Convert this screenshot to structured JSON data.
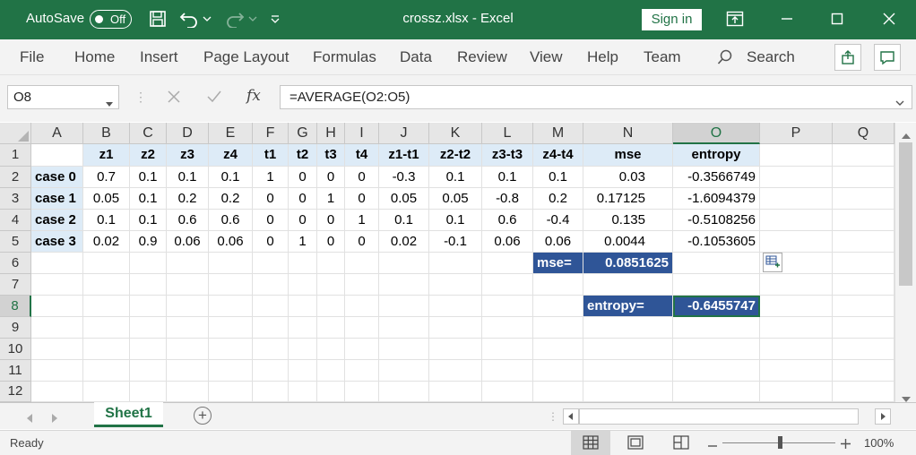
{
  "titlebar": {
    "autosave_label": "AutoSave",
    "autosave_state": "Off",
    "title": "crossz.xlsx  -  Excel",
    "sign_in": "Sign in",
    "icons": [
      "save-icon",
      "undo-icon",
      "redo-icon",
      "customize-qat-icon",
      "ribbon-display-icon",
      "minimize-icon",
      "maximize-icon",
      "close-icon"
    ]
  },
  "menu": {
    "items": [
      "File",
      "Home",
      "Insert",
      "Page Layout",
      "Formulas",
      "Data",
      "Review",
      "View",
      "Help",
      "Team"
    ],
    "search": "Search"
  },
  "formula_bar": {
    "name_box": "O8",
    "formula": "=AVERAGE(O2:O5)",
    "fx": "fx"
  },
  "sheet": {
    "columns": [
      "A",
      "B",
      "C",
      "D",
      "E",
      "F",
      "G",
      "H",
      "I",
      "J",
      "K",
      "L",
      "M",
      "N",
      "O",
      "P",
      "Q"
    ],
    "rows": [
      "1",
      "2",
      "3",
      "4",
      "5",
      "6",
      "7",
      "8",
      "9",
      "10",
      "11",
      "12"
    ],
    "header_row": [
      "",
      "z1",
      "z2",
      "z3",
      "z4",
      "t1",
      "t2",
      "t3",
      "t4",
      "z1-t1",
      "z2-t2",
      "z3-t3",
      "z4-t4",
      "mse",
      "entropy"
    ],
    "data_rows": [
      [
        "case 0",
        "0.7",
        "0.1",
        "0.1",
        "0.1",
        "1",
        "0",
        "0",
        "0",
        "-0.3",
        "0.1",
        "0.1",
        "0.1",
        "0.03",
        "-0.3566749"
      ],
      [
        "case 1",
        "0.05",
        "0.1",
        "0.2",
        "0.2",
        "0",
        "0",
        "1",
        "0",
        "0.05",
        "0.05",
        "-0.8",
        "0.2",
        "0.17125",
        "-1.6094379"
      ],
      [
        "case 2",
        "0.1",
        "0.1",
        "0.6",
        "0.6",
        "0",
        "0",
        "0",
        "1",
        "0.1",
        "0.1",
        "0.6",
        "-0.4",
        "0.135",
        "-0.5108256"
      ],
      [
        "case 3",
        "0.02",
        "0.9",
        "0.06",
        "0.06",
        "0",
        "1",
        "0",
        "0",
        "0.02",
        "-0.1",
        "0.06",
        "0.06",
        "0.0044",
        "-0.1053605"
      ]
    ],
    "mse_label": "mse=",
    "mse_value": "0.0851625",
    "entropy_label": "entropy=",
    "entropy_value": "-0.6455747",
    "selected_cell": "O8"
  },
  "tabs": {
    "sheets": [
      "Sheet1"
    ],
    "add_sheet": "+"
  },
  "status": {
    "ready": "Ready",
    "zoom": "100%"
  },
  "colors": {
    "title_green": "#217346",
    "header_fill": "#ddebf7",
    "dark_fill": "#2f5597"
  }
}
